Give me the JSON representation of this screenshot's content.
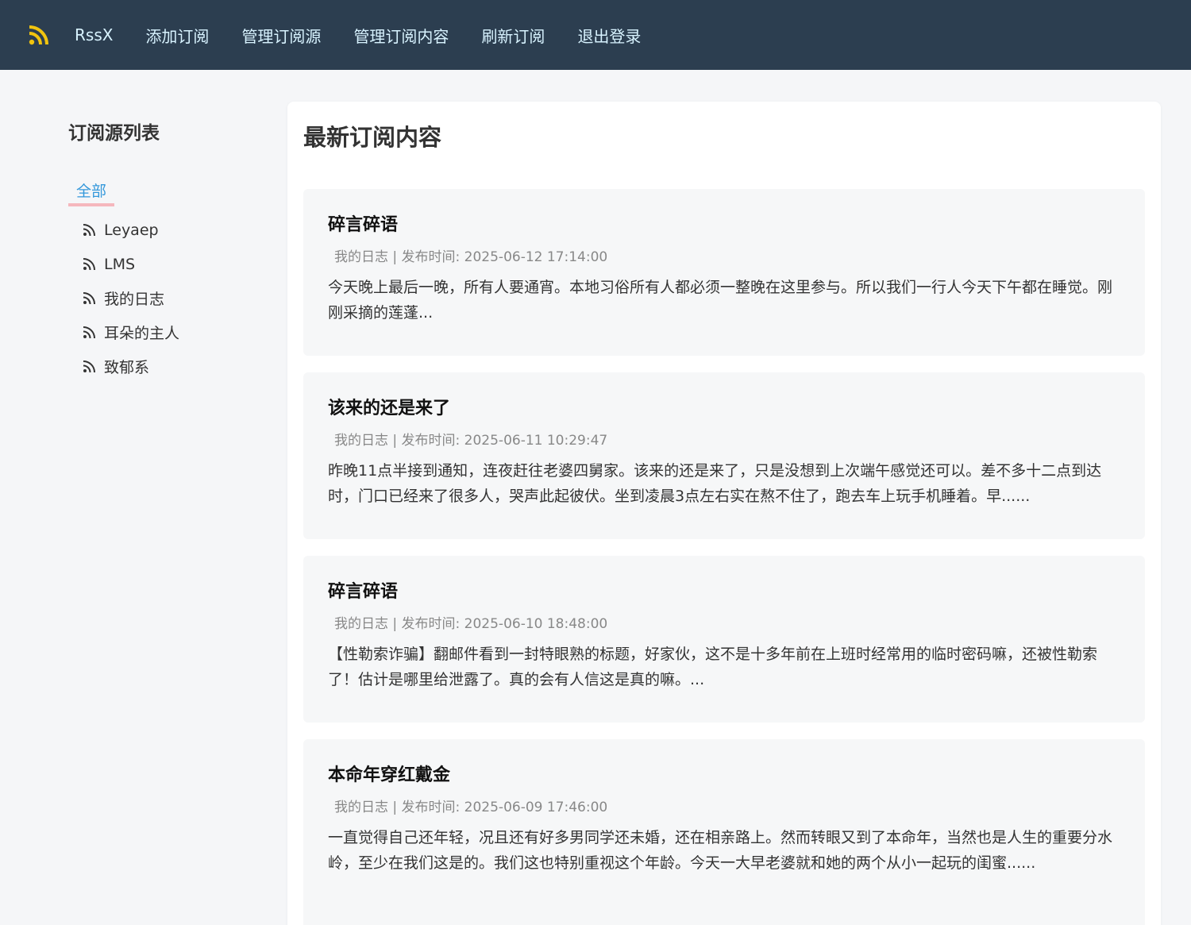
{
  "nav": {
    "brand": "RssX",
    "links": [
      "添加订阅",
      "管理订阅源",
      "管理订阅内容",
      "刷新订阅",
      "退出登录"
    ],
    "logo_color": "#f1c40f"
  },
  "sidebar": {
    "title": "订阅源列表",
    "all_label": "全部",
    "feeds": [
      "Leyaep",
      "LMS",
      "我的日志",
      "耳朵的主人",
      "致郁系"
    ]
  },
  "main": {
    "title": "最新订阅内容",
    "articles": [
      {
        "title": "碎言碎语",
        "meta": "我的日志 | 发布时间: 2025-06-12 17:14:00",
        "summary": "今天晚上最后一晚，所有人要通宵。本地习俗所有人都必须一整晚在这里参与。所以我们一行人今天下午都在睡觉。刚刚采摘的莲蓬..."
      },
      {
        "title": "该来的还是来了",
        "meta": "我的日志 | 发布时间: 2025-06-11 10:29:47",
        "summary": "昨晚11点半接到通知，连夜赶往老婆四舅家。该来的还是来了，只是没想到上次端午感觉还可以。差不多十二点到达时，门口已经来了很多人，哭声此起彼伏。坐到凌晨3点左右实在熬不住了，跑去车上玩手机睡着。早......"
      },
      {
        "title": "碎言碎语",
        "meta": "我的日志 | 发布时间: 2025-06-10 18:48:00",
        "summary": "【性勒索诈骗】翻邮件看到一封特眼熟的标题，好家伙，这不是十多年前在上班时经常用的临时密码嘛，还被性勒索了！估计是哪里给泄露了。真的会有人信这是真的嘛。..."
      },
      {
        "title": "本命年穿红戴金",
        "meta": "我的日志 | 发布时间: 2025-06-09 17:46:00",
        "summary": "一直觉得自己还年轻，况且还有好多男同学还未婚，还在相亲路上。然而转眼又到了本命年，当然也是人生的重要分水岭，至少在我们这是的。我们这也特别重视这个年龄。今天一大早老婆就和她的两个从小一起玩的闺蜜......"
      }
    ]
  }
}
